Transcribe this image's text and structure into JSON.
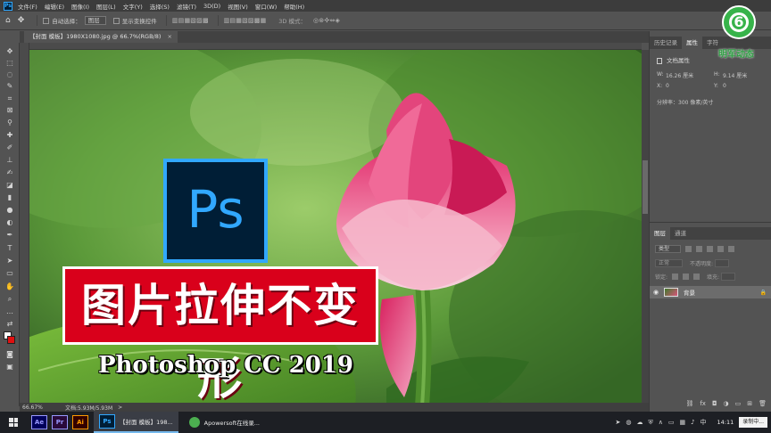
{
  "menubar": {
    "app_logo": "Ps",
    "items": [
      "文件(F)",
      "编辑(E)",
      "图像(I)",
      "图层(L)",
      "文字(Y)",
      "选择(S)",
      "滤镜(T)",
      "3D(D)",
      "视图(V)",
      "窗口(W)",
      "帮助(H)"
    ]
  },
  "options": {
    "auto_select_label": "自动选择：",
    "auto_select_value": "图层",
    "show_transform_label": "显示变换控件",
    "mode_label": "3D 模式："
  },
  "document": {
    "tab_label": "【封面 模板】1980X1080.jpg @ 66.7%(RGB/8)",
    "close_glyph": "×"
  },
  "canvas": {
    "ps_logo_text": "Ps",
    "banner_text": "图片拉伸不变形",
    "subtitle_text": "Photoshop CC 2019"
  },
  "statusbar": {
    "zoom": "66.67%",
    "doc_info": "文档:5.93M/5.93M",
    "caret": ">"
  },
  "properties_panel": {
    "tabs": [
      "历史记录",
      "属性",
      "字符"
    ],
    "title": "文档属性",
    "width_label": "W:",
    "width_value": "16.26 厘米",
    "height_label": "H:",
    "height_value": "9.14 厘米",
    "x_label": "X:",
    "x_value": "0",
    "y_label": "Y:",
    "y_value": "0",
    "resolution": "分辨率：300 像素/英寸"
  },
  "layers_panel": {
    "tabs": [
      "图层",
      "通道"
    ],
    "kind_filter": "类型",
    "blend_mode": "正常",
    "opacity_label": "不透明度:",
    "lock_label": "锁定:",
    "fill_label": "填充:",
    "layer_name": "背景"
  },
  "watermark": {
    "glyph": "6",
    "text": "明军动态"
  },
  "taskbar": {
    "apps": [
      {
        "label": "Ae",
        "color": "#9999ff",
        "bg": "#00005b"
      },
      {
        "label": "Pr",
        "color": "#9999ff",
        "bg": "#2a0a3a"
      },
      {
        "label": "Ai",
        "color": "#ff9a00",
        "bg": "#330000"
      },
      {
        "label": "Ps",
        "color": "#31a8ff",
        "bg": "#001e36"
      }
    ],
    "task_ps": "【封面 模板】198...",
    "task_apowersoft": "Apowersoft在线录...",
    "clock": "14:11",
    "recording_badge": "录制中..."
  },
  "colors": {
    "ps_blue": "#31a8ff",
    "banner_red": "#d9001b",
    "watermark_green": "#37b34a"
  }
}
